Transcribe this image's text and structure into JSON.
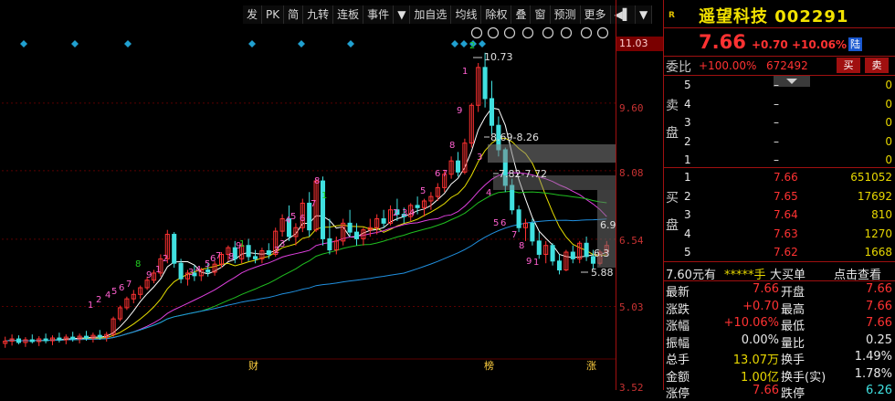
{
  "toolbar": {
    "buttons": [
      "发",
      "PK",
      "简",
      "九转",
      "连板",
      "事件",
      "▼",
      "加自选",
      "均线",
      "除权",
      "叠",
      "窗",
      "预测",
      "更多",
      "◀▌",
      "▼"
    ]
  },
  "chart_data": {
    "type": "candlestick",
    "y_axis_ticks": [
      "11.03",
      "9.60",
      "8.08",
      "6.54",
      "5.03",
      "3.52"
    ],
    "ylim": [
      3.5,
      11.3
    ],
    "candles": [
      {
        "o": 4.2,
        "h": 4.35,
        "l": 4.1,
        "c": 4.25
      },
      {
        "o": 4.25,
        "h": 4.4,
        "l": 4.15,
        "c": 4.3
      },
      {
        "o": 4.3,
        "h": 4.38,
        "l": 4.18,
        "c": 4.22
      },
      {
        "o": 4.22,
        "h": 4.34,
        "l": 4.12,
        "c": 4.28
      },
      {
        "o": 4.28,
        "h": 4.4,
        "l": 4.2,
        "c": 4.24
      },
      {
        "o": 4.24,
        "h": 4.36,
        "l": 4.14,
        "c": 4.3
      },
      {
        "o": 4.3,
        "h": 4.42,
        "l": 4.2,
        "c": 4.26
      },
      {
        "o": 4.26,
        "h": 4.38,
        "l": 4.16,
        "c": 4.32
      },
      {
        "o": 4.32,
        "h": 4.44,
        "l": 4.22,
        "c": 4.28
      },
      {
        "o": 4.28,
        "h": 4.4,
        "l": 4.18,
        "c": 4.34
      },
      {
        "o": 4.34,
        "h": 4.46,
        "l": 4.24,
        "c": 4.3
      },
      {
        "o": 4.3,
        "h": 4.42,
        "l": 4.2,
        "c": 4.36
      },
      {
        "o": 4.36,
        "h": 4.48,
        "l": 4.26,
        "c": 4.32
      },
      {
        "o": 4.32,
        "h": 4.44,
        "l": 4.22,
        "c": 4.38
      },
      {
        "o": 4.38,
        "h": 4.5,
        "l": 4.28,
        "c": 4.34
      },
      {
        "o": 4.34,
        "h": 4.46,
        "l": 4.24,
        "c": 4.4
      },
      {
        "o": 4.4,
        "h": 4.8,
        "l": 4.35,
        "c": 4.75
      },
      {
        "o": 4.75,
        "h": 5.05,
        "l": 4.7,
        "c": 5.0
      },
      {
        "o": 5.0,
        "h": 5.25,
        "l": 4.95,
        "c": 5.2
      },
      {
        "o": 5.2,
        "h": 5.4,
        "l": 5.1,
        "c": 5.3
      },
      {
        "o": 5.3,
        "h": 5.5,
        "l": 5.2,
        "c": 5.45
      },
      {
        "o": 5.45,
        "h": 5.7,
        "l": 5.4,
        "c": 5.62
      },
      {
        "o": 5.62,
        "h": 5.85,
        "l": 5.55,
        "c": 5.78
      },
      {
        "o": 5.78,
        "h": 6.2,
        "l": 5.7,
        "c": 6.1
      },
      {
        "o": 6.1,
        "h": 6.75,
        "l": 6.0,
        "c": 6.65
      },
      {
        "o": 6.65,
        "h": 6.7,
        "l": 5.9,
        "c": 6.0
      },
      {
        "o": 6.0,
        "h": 6.1,
        "l": 5.55,
        "c": 5.65
      },
      {
        "o": 5.65,
        "h": 5.85,
        "l": 5.5,
        "c": 5.78
      },
      {
        "o": 5.78,
        "h": 5.95,
        "l": 5.6,
        "c": 5.72
      },
      {
        "o": 5.72,
        "h": 5.9,
        "l": 5.6,
        "c": 5.85
      },
      {
        "o": 5.85,
        "h": 6.0,
        "l": 5.7,
        "c": 5.8
      },
      {
        "o": 5.8,
        "h": 6.05,
        "l": 5.72,
        "c": 5.98
      },
      {
        "o": 5.98,
        "h": 6.25,
        "l": 5.9,
        "c": 6.2
      },
      {
        "o": 6.2,
        "h": 6.4,
        "l": 6.05,
        "c": 6.35
      },
      {
        "o": 6.35,
        "h": 6.5,
        "l": 6.0,
        "c": 6.1
      },
      {
        "o": 6.1,
        "h": 6.45,
        "l": 6.0,
        "c": 6.4
      },
      {
        "o": 6.4,
        "h": 6.55,
        "l": 6.05,
        "c": 6.15
      },
      {
        "o": 6.15,
        "h": 6.3,
        "l": 6.0,
        "c": 6.1
      },
      {
        "o": 6.1,
        "h": 6.35,
        "l": 6.0,
        "c": 6.28
      },
      {
        "o": 6.28,
        "h": 6.45,
        "l": 6.1,
        "c": 6.2
      },
      {
        "o": 6.2,
        "h": 6.8,
        "l": 6.15,
        "c": 6.72
      },
      {
        "o": 6.72,
        "h": 7.1,
        "l": 6.6,
        "c": 7.0
      },
      {
        "o": 7.0,
        "h": 7.3,
        "l": 6.5,
        "c": 6.6
      },
      {
        "o": 6.6,
        "h": 6.9,
        "l": 6.4,
        "c": 6.8
      },
      {
        "o": 6.8,
        "h": 7.45,
        "l": 6.7,
        "c": 7.35
      },
      {
        "o": 7.35,
        "h": 7.6,
        "l": 6.6,
        "c": 6.75
      },
      {
        "o": 6.75,
        "h": 7.9,
        "l": 6.7,
        "c": 7.85
      },
      {
        "o": 7.85,
        "h": 7.95,
        "l": 6.4,
        "c": 6.55
      },
      {
        "o": 6.55,
        "h": 7.0,
        "l": 6.2,
        "c": 6.3
      },
      {
        "o": 6.3,
        "h": 6.6,
        "l": 6.2,
        "c": 6.5
      },
      {
        "o": 6.5,
        "h": 7.0,
        "l": 6.4,
        "c": 6.9
      },
      {
        "o": 6.9,
        "h": 7.2,
        "l": 6.6,
        "c": 6.7
      },
      {
        "o": 6.7,
        "h": 6.9,
        "l": 6.4,
        "c": 6.55
      },
      {
        "o": 6.55,
        "h": 6.8,
        "l": 6.4,
        "c": 6.75
      },
      {
        "o": 6.75,
        "h": 7.0,
        "l": 6.6,
        "c": 6.8
      },
      {
        "o": 6.8,
        "h": 7.1,
        "l": 6.65,
        "c": 7.0
      },
      {
        "o": 7.0,
        "h": 7.2,
        "l": 6.8,
        "c": 6.9
      },
      {
        "o": 6.9,
        "h": 7.3,
        "l": 6.85,
        "c": 7.2
      },
      {
        "o": 7.2,
        "h": 7.45,
        "l": 6.95,
        "c": 7.1
      },
      {
        "o": 7.1,
        "h": 7.25,
        "l": 6.9,
        "c": 7.05
      },
      {
        "o": 7.05,
        "h": 7.35,
        "l": 6.95,
        "c": 7.3
      },
      {
        "o": 7.3,
        "h": 7.5,
        "l": 7.1,
        "c": 7.25
      },
      {
        "o": 7.25,
        "h": 7.45,
        "l": 7.05,
        "c": 7.4
      },
      {
        "o": 7.4,
        "h": 7.6,
        "l": 7.2,
        "c": 7.5
      },
      {
        "o": 7.5,
        "h": 7.8,
        "l": 7.4,
        "c": 7.7
      },
      {
        "o": 7.7,
        "h": 8.1,
        "l": 7.6,
        "c": 8.0
      },
      {
        "o": 8.0,
        "h": 8.4,
        "l": 7.9,
        "c": 8.3
      },
      {
        "o": 8.3,
        "h": 8.5,
        "l": 7.95,
        "c": 8.05
      },
      {
        "o": 8.05,
        "h": 8.8,
        "l": 8.0,
        "c": 8.7
      },
      {
        "o": 8.7,
        "h": 9.6,
        "l": 8.6,
        "c": 9.55
      },
      {
        "o": 9.55,
        "h": 10.5,
        "l": 9.4,
        "c": 10.4
      },
      {
        "o": 10.4,
        "h": 10.73,
        "l": 9.5,
        "c": 9.7
      },
      {
        "o": 9.7,
        "h": 10.1,
        "l": 8.9,
        "c": 9.1
      },
      {
        "o": 9.1,
        "h": 9.3,
        "l": 8.4,
        "c": 8.55
      },
      {
        "o": 8.55,
        "h": 8.6,
        "l": 7.6,
        "c": 7.75
      },
      {
        "o": 7.75,
        "h": 7.9,
        "l": 7.1,
        "c": 7.2
      },
      {
        "o": 7.2,
        "h": 7.3,
        "l": 6.7,
        "c": 6.8
      },
      {
        "o": 6.8,
        "h": 7.0,
        "l": 6.5,
        "c": 6.9
      },
      {
        "o": 6.9,
        "h": 7.0,
        "l": 6.4,
        "c": 6.5
      },
      {
        "o": 6.5,
        "h": 6.7,
        "l": 6.1,
        "c": 6.2
      },
      {
        "o": 6.2,
        "h": 6.5,
        "l": 6.0,
        "c": 6.4
      },
      {
        "o": 6.4,
        "h": 6.45,
        "l": 5.95,
        "c": 6.05
      },
      {
        "o": 6.05,
        "h": 6.2,
        "l": 5.75,
        "c": 5.85
      },
      {
        "o": 5.85,
        "h": 6.3,
        "l": 5.82,
        "c": 6.25
      },
      {
        "o": 6.25,
        "h": 6.4,
        "l": 6.0,
        "c": 6.1
      },
      {
        "o": 6.1,
        "h": 6.5,
        "l": 6.0,
        "c": 6.45
      },
      {
        "o": 6.45,
        "h": 6.6,
        "l": 6.05,
        "c": 6.15
      },
      {
        "o": 6.15,
        "h": 6.3,
        "l": 5.88,
        "c": 6.0
      },
      {
        "o": 6.0,
        "h": 6.3,
        "l": 5.95,
        "c": 6.25
      },
      {
        "o": 6.25,
        "h": 6.5,
        "l": 6.15,
        "c": 6.4
      }
    ],
    "annotations": {
      "high": "10.73",
      "level1": "8.69-8.26",
      "level2": "7.82-7.72",
      "low": "5.88",
      "mid_right": "6.3",
      "upper_right": "6.9"
    },
    "bottom_markers": [
      "财",
      "榜",
      "涨"
    ],
    "number_labels": [
      "1",
      "2",
      "4",
      "5",
      "6",
      "7",
      "8",
      "9",
      "1",
      "2",
      "3",
      "4",
      "5",
      "6",
      "7",
      "8",
      "9",
      "1",
      "2",
      "3",
      "4",
      "5",
      "6",
      "7",
      "8",
      "1",
      "2",
      "3",
      "4",
      "5",
      "6",
      "7",
      "8",
      "9",
      "1",
      "2",
      "3",
      "4",
      "5",
      "6",
      "7",
      "8",
      "9",
      "1",
      "2",
      "3",
      "4",
      "5",
      "6",
      "7",
      "8",
      "9"
    ]
  },
  "stock": {
    "name": "遥望科技",
    "code": "002291",
    "price": "7.66",
    "change": "+0.70",
    "change_pct": "+10.06%",
    "tag": "陆",
    "r_tag": "R"
  },
  "order_book": {
    "ratio_label": "委比",
    "ratio_pct": "+100.00%",
    "ratio_diff": "672492",
    "buy_btn": "买",
    "sell_btn": "卖",
    "sell_side_label": "卖盘",
    "buy_side_label": "买盘",
    "sells": [
      {
        "level": "5",
        "price": "–",
        "vol": "0"
      },
      {
        "level": "4",
        "price": "–",
        "vol": "0"
      },
      {
        "level": "3",
        "price": "–",
        "vol": "0"
      },
      {
        "level": "2",
        "price": "–",
        "vol": "0"
      },
      {
        "level": "1",
        "price": "–",
        "vol": "0"
      }
    ],
    "buys": [
      {
        "level": "1",
        "price": "7.66",
        "vol": "651052"
      },
      {
        "level": "2",
        "price": "7.65",
        "vol": "17692"
      },
      {
        "level": "3",
        "price": "7.64",
        "vol": "810"
      },
      {
        "level": "4",
        "price": "7.63",
        "vol": "1270"
      },
      {
        "level": "5",
        "price": "7.62",
        "vol": "1668"
      }
    ]
  },
  "big_order": {
    "text1": "7.60元有",
    "text2": "*****手",
    "text3": "大买单",
    "link": "点击查看"
  },
  "stats": [
    {
      "l1": "最新",
      "v1": "7.66",
      "l2": "开盘",
      "v2": "7.66"
    },
    {
      "l1": "涨跌",
      "v1": "+0.70",
      "l2": "最高",
      "v2": "7.66"
    },
    {
      "l1": "涨幅",
      "v1": "+10.06%",
      "l2": "最低",
      "v2": "7.66"
    },
    {
      "l1": "振幅",
      "v1": "0.00%",
      "l2": "量比",
      "v2": "0.25"
    },
    {
      "l1": "总手",
      "v1": "13.07万",
      "l2": "换手",
      "v2": "1.49%"
    },
    {
      "l1": "金额",
      "v1": "1.00亿",
      "l2": "换手(实)",
      "v2": "1.78%"
    },
    {
      "l1": "涨停",
      "v1": "7.66",
      "l2": "跌停",
      "v2": "6.26"
    }
  ],
  "colors": {
    "up": "#ff3232",
    "down": "#40e0e0",
    "ma5": "#ffffff",
    "ma10": "#e8e000",
    "ma20": "#e040e0",
    "ma30": "#20c020",
    "ma60": "#2090e0",
    "bg": "#000000"
  }
}
